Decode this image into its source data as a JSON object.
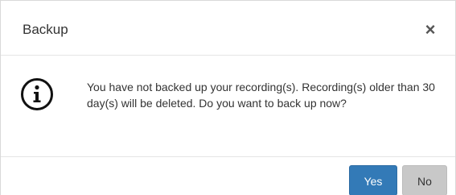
{
  "dialog": {
    "title": "Backup",
    "close_glyph": "×",
    "icon": "info-icon",
    "message": "You have not backed up your recording(s). Recording(s) older than 30 day(s) will be deleted. Do you want to back up now?",
    "buttons": {
      "yes_label": "Yes",
      "no_label": "No"
    }
  },
  "colors": {
    "primary": "#337ab7",
    "secondary": "#c8c8c8"
  }
}
